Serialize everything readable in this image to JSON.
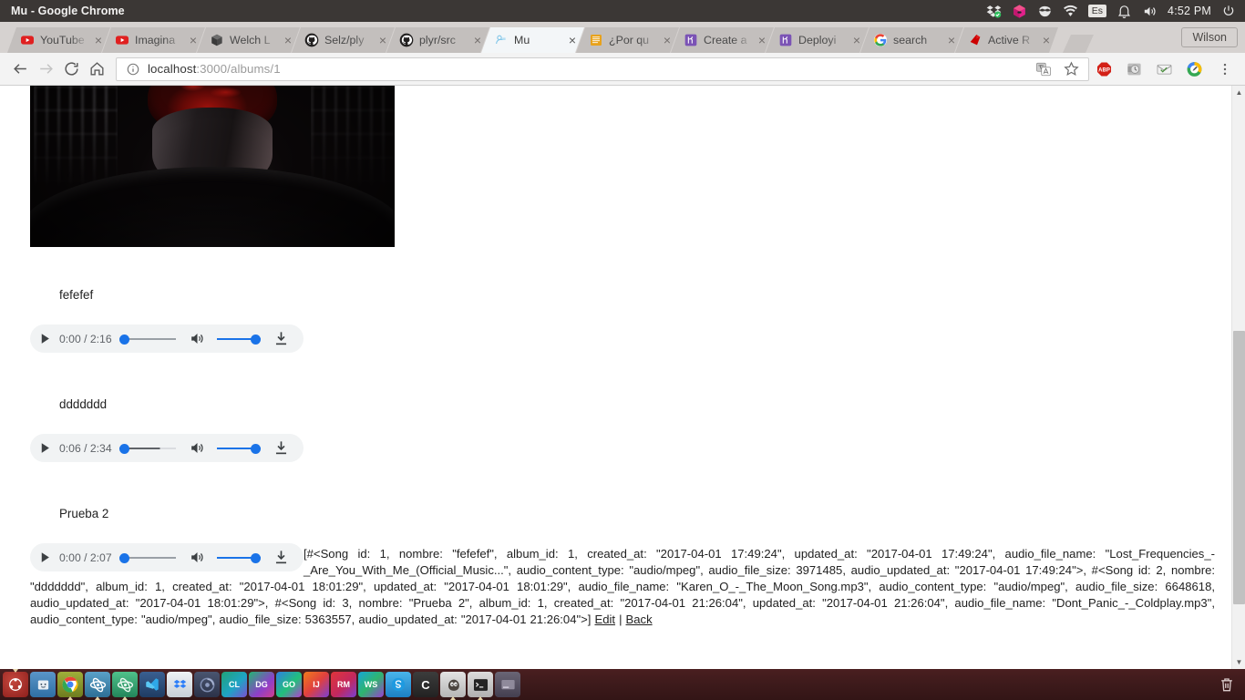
{
  "desktop": {
    "window_title": "Mu - Google Chrome",
    "tray": {
      "icons": [
        "dropbox-icon",
        "cube-icon",
        "mask-icon",
        "wifi-icon"
      ],
      "keyboard_layout": "Es",
      "bell_icon": "bell-icon",
      "volume_icon": "volume-icon",
      "clock": "4:52 PM",
      "power_icon": "power-icon"
    },
    "dock": {
      "items": [
        {
          "name": "ubuntu-dash",
          "label": "",
          "color": "#a62822",
          "running": false,
          "pinned": true
        },
        {
          "name": "files",
          "label": "",
          "color": "#3b7cb5",
          "running": false,
          "pinned": false
        },
        {
          "name": "google-chrome",
          "label": "",
          "color": "#8a9b2e",
          "running": true,
          "pinned": false
        },
        {
          "name": "atom-beta",
          "label": "",
          "color": "#3e7fa8",
          "running": true,
          "pinned": false
        },
        {
          "name": "atom",
          "label": "",
          "color": "#2e9e6b",
          "running": true,
          "pinned": false
        },
        {
          "name": "visual-studio-code",
          "label": "",
          "color": "#2b4f78",
          "running": false,
          "pinned": false
        },
        {
          "name": "dropbox",
          "label": "",
          "color": "#dfe4e8",
          "running": false,
          "pinned": false
        },
        {
          "name": "firefox-dev",
          "label": "",
          "color": "#3a3f52",
          "running": false,
          "pinned": false
        },
        {
          "name": "clion",
          "label": "CL",
          "color": "#1f8f6b",
          "running": false,
          "pinned": false
        },
        {
          "name": "datagrip",
          "label": "DG",
          "color": "#8a3fa8",
          "running": false,
          "pinned": false
        },
        {
          "name": "goland",
          "label": "GO",
          "color": "#3b6fd1",
          "running": false,
          "pinned": false
        },
        {
          "name": "intellij-idea",
          "label": "IJ",
          "color": "#d9731f",
          "running": false,
          "pinned": false
        },
        {
          "name": "rubymine",
          "label": "RM",
          "color": "#c7312e",
          "running": false,
          "pinned": false
        },
        {
          "name": "webstorm",
          "label": "WS",
          "color": "#1b9fd8",
          "running": false,
          "pinned": false
        },
        {
          "name": "skype",
          "label": "",
          "color": "#1b9fd8",
          "running": false,
          "pinned": false
        },
        {
          "name": "crashplan",
          "label": "C",
          "color": "#2f2f2f",
          "running": false,
          "pinned": false
        },
        {
          "name": "gimp",
          "label": "",
          "color": "#d6d6d6",
          "running": true,
          "pinned": false
        },
        {
          "name": "terminal",
          "label": "",
          "color": "#cdcdcd",
          "running": true,
          "pinned": false
        },
        {
          "name": "system-settings",
          "label": "",
          "color": "#5a5560",
          "running": false,
          "pinned": false
        }
      ],
      "trash_label": "trash-icon"
    }
  },
  "browser": {
    "tabs": [
      {
        "label": "YouTube",
        "favicon": "youtube-icon",
        "active": false
      },
      {
        "label": "Imagina",
        "favicon": "youtube-icon",
        "active": false
      },
      {
        "label": "Welch L",
        "favicon": "box-icon",
        "active": false
      },
      {
        "label": "Selz/ply",
        "favicon": "github-icon",
        "active": false
      },
      {
        "label": "plyr/src",
        "favicon": "github-icon",
        "active": false
      },
      {
        "label": "Mu",
        "favicon": "rails-icon",
        "active": true
      },
      {
        "label": "¿Por qu",
        "favicon": "book-icon",
        "active": false
      },
      {
        "label": "Create a",
        "favicon": "heroku-icon",
        "active": false
      },
      {
        "label": "Deployi",
        "favicon": "heroku-icon",
        "active": false
      },
      {
        "label": "search",
        "favicon": "google-icon",
        "active": false
      },
      {
        "label": "Active R",
        "favicon": "ruby-icon",
        "active": false
      }
    ],
    "new_tab_label": "new-tab-button",
    "profile_name": "Wilson",
    "nav": {
      "back_label": "back-button",
      "forward_label": "forward-button",
      "reload_label": "reload-button",
      "home_label": "home-button"
    },
    "omnibox": {
      "url_host": "localhost",
      "url_rest": ":3000/albums/1",
      "security_icon": "info-icon",
      "translate_icon": "translate-icon",
      "bookmark_icon": "star-icon"
    },
    "extensions": [
      {
        "name": "adblock-plus-icon",
        "label": "ABP"
      },
      {
        "name": "history-clock-icon",
        "label": ""
      },
      {
        "name": "mail-icon",
        "label": ""
      },
      {
        "name": "pencil-circle-icon",
        "label": ""
      }
    ],
    "menu_label": "chrome-menu-button"
  },
  "page": {
    "album_art_alt": "album-cover-image",
    "songs": [
      {
        "title": "fefefef",
        "player": {
          "play_label": "play-button",
          "time": "0:00 / 2:16",
          "progress_pct": 0,
          "volume_pct": 100,
          "volume_label": "volume-button",
          "download_label": "download-button"
        }
      },
      {
        "title": "ddddddd",
        "player": {
          "play_label": "play-button",
          "time": "0:06 / 2:34",
          "progress_pct": 4,
          "volume_pct": 100,
          "volume_label": "volume-button",
          "download_label": "download-button"
        }
      },
      {
        "title": "Prueba 2",
        "player": {
          "play_label": "play-button",
          "time": "0:00 / 2:07",
          "progress_pct": 0,
          "volume_pct": 100,
          "volume_label": "volume-button",
          "download_label": "download-button"
        }
      }
    ],
    "debug_dump": "[#<Song id: 1, nombre: \"fefefef\", album_id: 1, created_at: \"2017-04-01 17:49:24\", updated_at: \"2017-04-01 17:49:24\", audio_file_name: \"Lost_Frequencies_-_Are_You_With_Me_(Official_Music...\", audio_content_type: \"audio/mpeg\", audio_file_size: 3971485, audio_updated_at: \"2017-04-01 17:49:24\">, #<Song id: 2, nombre: \"ddddddd\", album_id: 1, created_at: \"2017-04-01 18:01:29\", updated_at: \"2017-04-01 18:01:29\", audio_file_name: \"Karen_O_-_The_Moon_Song.mp3\", audio_content_type: \"audio/mpeg\", audio_file_size: 6648618, audio_updated_at: \"2017-04-01 18:01:29\">, #<Song id: 3, nombre: \"Prueba 2\", album_id: 1, created_at: \"2017-04-01 21:26:04\", updated_at: \"2017-04-01 21:26:04\", audio_file_name: \"Dont_Panic_-_Coldplay.mp3\", audio_content_type: \"audio/mpeg\", audio_file_size: 5363557, audio_updated_at: \"2017-04-01 21:26:04\">]",
    "edit_link": "Edit",
    "link_separator": "|",
    "back_link": "Back"
  },
  "colors": {
    "accent_blue": "#1a73e8",
    "player_bg": "#f1f3f4",
    "unity_panel": "#3b3735",
    "dock_bg": "#3d1a1b",
    "chrome_frame": "#d6d2d0"
  }
}
